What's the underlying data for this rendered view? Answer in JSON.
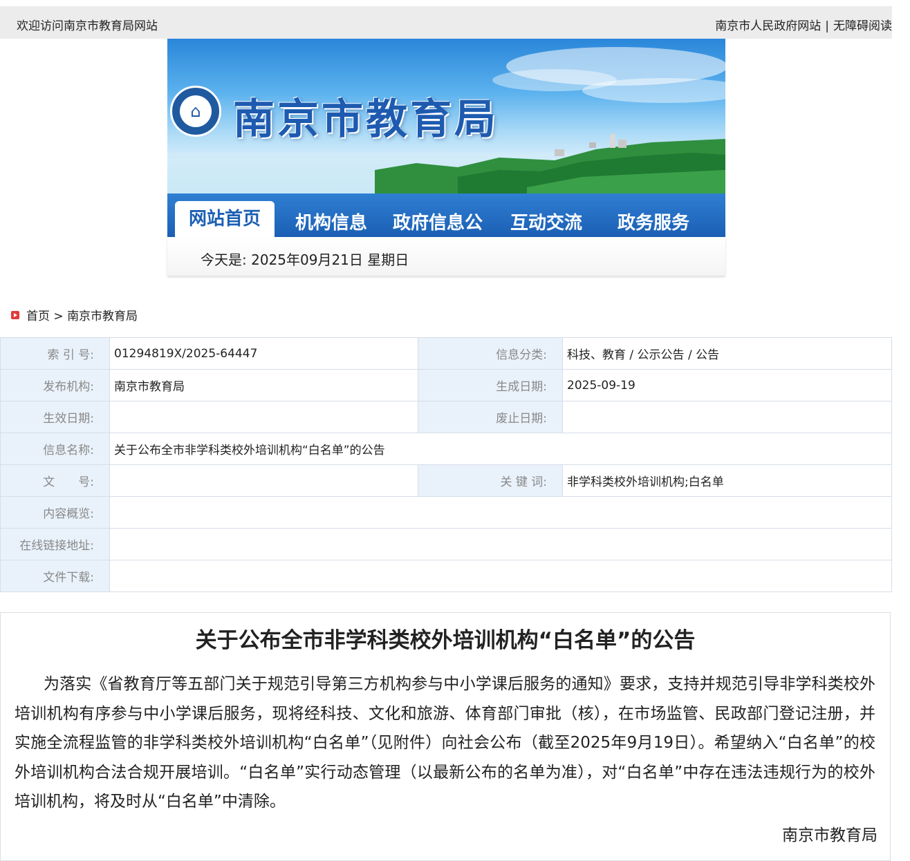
{
  "topbar": {
    "welcome": "欢迎访问南京市教育局网站",
    "link_gov": "南京市人民政府网站",
    "separator": "|",
    "link_accessible": "无障碍阅读"
  },
  "banner": {
    "site_title": "南京市教育局"
  },
  "nav": {
    "items": [
      "网站首页",
      "机构信息",
      "政府信息公",
      "互动交流",
      "政务服务"
    ]
  },
  "datebar": {
    "text": "今天是: 2025年09月21日 星期日"
  },
  "breadcrumb": {
    "home": "首页",
    "sep": " > ",
    "current": "南京市教育局"
  },
  "meta": {
    "index_label": "索 引 号:",
    "index_value": "01294819X/2025-64447",
    "category_label": "信息分类:",
    "category_value": "科技、教育 / 公示公告 / 公告",
    "publisher_label": "发布机构:",
    "publisher_value": "南京市教育局",
    "created_label": "生成日期:",
    "created_value": "2025-09-19",
    "effective_label": "生效日期:",
    "effective_value": "",
    "repeal_label": "废止日期:",
    "repeal_value": "",
    "name_label": "信息名称:",
    "name_value": "关于公布全市非学科类校外培训机构“白名单”的公告",
    "docno_label": "文　　号:",
    "docno_value": "",
    "keywords_label": "关 键 词:",
    "keywords_value": "非学科类校外培训机构;白名单",
    "summary_label": "内容概览:",
    "summary_value": "",
    "link_label": "在线链接地址:",
    "link_value": "",
    "download_label": "文件下载:",
    "download_value": ""
  },
  "article": {
    "title": "关于公布全市非学科类校外培训机构“白名单”的公告",
    "body": "为落实《省教育厅等五部门关于规范引导第三方机构参与中小学课后服务的通知》要求，支持并规范引导非学科类校外培训机构有序参与中小学课后服务，现将经科技、文化和旅游、体育部门审批（核），在市场监管、民政部门登记注册，并实施全流程监管的非学科类校外培训机构“白名单”（见附件）向社会公布（截至2025年9月19日）。希望纳入“白名单”的校外培训机构合法合规开展培训。“白名单”实行动态管理（以最新公布的名单为准），对“白名单”中存在违法违规行为的校外培训机构，将及时从“白名单”中清除。",
    "signature": "南京市教育局"
  },
  "colors": {
    "nav_blue": "#1b5fb4",
    "label_bg": "#e9f2fb",
    "topbar_bg": "#ececec"
  }
}
